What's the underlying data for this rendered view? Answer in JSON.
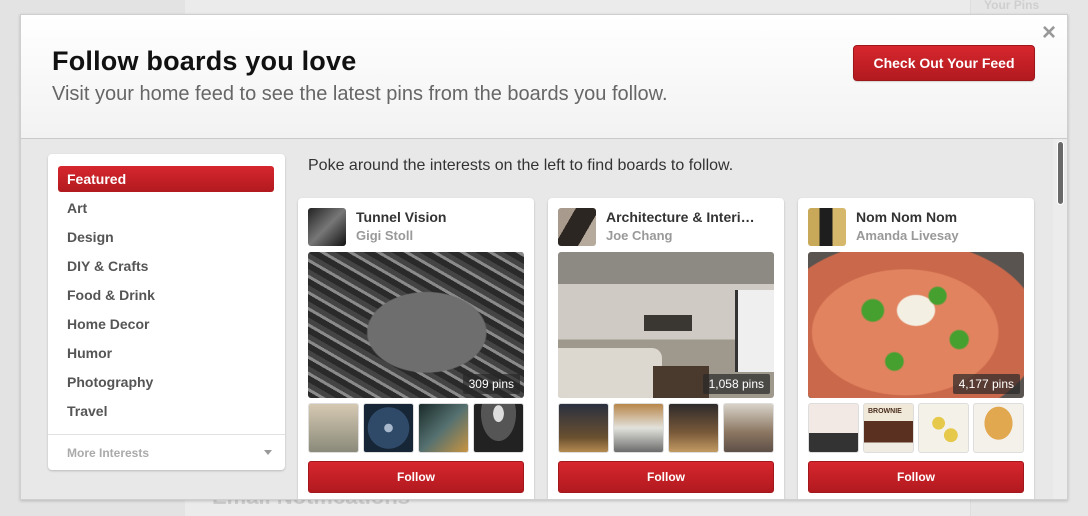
{
  "background": {
    "top_right_link": "Your Pins",
    "section_heading": "Email Notifications"
  },
  "modal": {
    "title": "Follow boards you love",
    "subtitle": "Visit your home feed to see the latest pins from the boards you follow.",
    "primary_button": "Check Out Your Feed",
    "close_icon": "×",
    "accent_color": "#c8232c"
  },
  "sidebar": {
    "items": [
      {
        "label": "Featured",
        "active": true
      },
      {
        "label": "Art",
        "active": false
      },
      {
        "label": "Design",
        "active": false
      },
      {
        "label": "DIY & Crafts",
        "active": false
      },
      {
        "label": "Food & Drink",
        "active": false
      },
      {
        "label": "Home Decor",
        "active": false
      },
      {
        "label": "Humor",
        "active": false
      },
      {
        "label": "Photography",
        "active": false
      },
      {
        "label": "Travel",
        "active": false
      }
    ],
    "more_label": "More Interests"
  },
  "main": {
    "intro": "Poke around the interests on the left to find boards to follow.",
    "boards": [
      {
        "title": "Tunnel Vision",
        "owner": "Gigi Stoll",
        "pins": "309 pins",
        "follow_label": "Follow"
      },
      {
        "title": "Architecture & Interi…",
        "owner": "Joe Chang",
        "pins": "1,058 pins",
        "follow_label": "Follow"
      },
      {
        "title": "Nom Nom Nom",
        "owner": "Amanda Livesay",
        "pins": "4,177 pins",
        "follow_label": "Follow",
        "thumb_label": "BROWNIE"
      }
    ]
  }
}
